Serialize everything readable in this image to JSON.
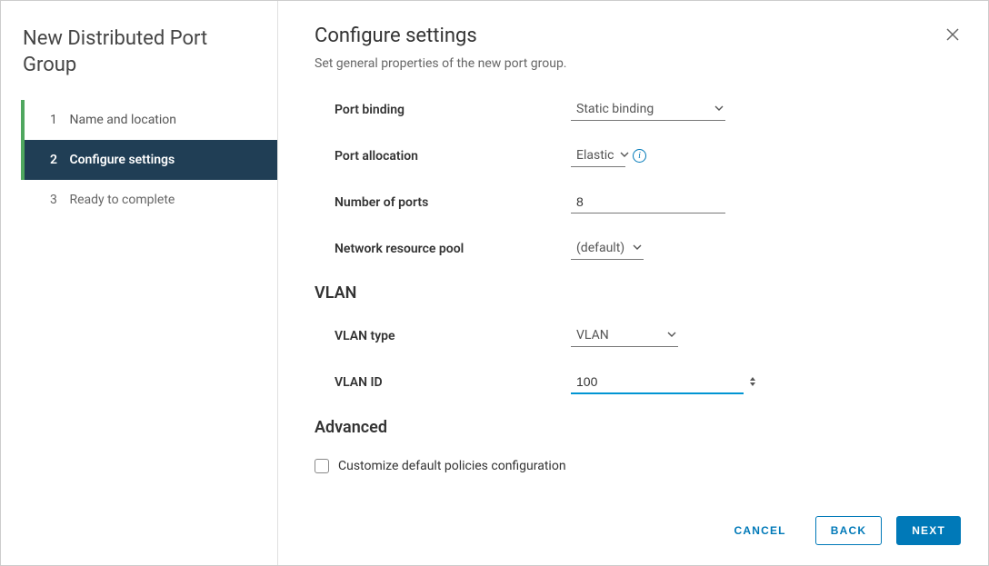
{
  "wizard": {
    "title": "New Distributed Port Group",
    "steps": [
      {
        "num": "1",
        "label": "Name and location"
      },
      {
        "num": "2",
        "label": "Configure settings"
      },
      {
        "num": "3",
        "label": "Ready to complete"
      }
    ],
    "active_index": 1
  },
  "main": {
    "title": "Configure settings",
    "subtitle": "Set general properties of the new port group."
  },
  "fields": {
    "port_binding": {
      "label": "Port binding",
      "value": "Static binding"
    },
    "port_allocation": {
      "label": "Port allocation",
      "value": "Elastic"
    },
    "num_ports": {
      "label": "Number of ports",
      "value": "8"
    },
    "net_pool": {
      "label": "Network resource pool",
      "value": "(default)"
    }
  },
  "vlan": {
    "section": "VLAN",
    "type": {
      "label": "VLAN type",
      "value": "VLAN"
    },
    "id": {
      "label": "VLAN ID",
      "value": "100"
    }
  },
  "advanced": {
    "section": "Advanced",
    "customize_label": "Customize default policies configuration",
    "customize_checked": false
  },
  "footer": {
    "cancel": "CANCEL",
    "back": "BACK",
    "next": "NEXT"
  }
}
